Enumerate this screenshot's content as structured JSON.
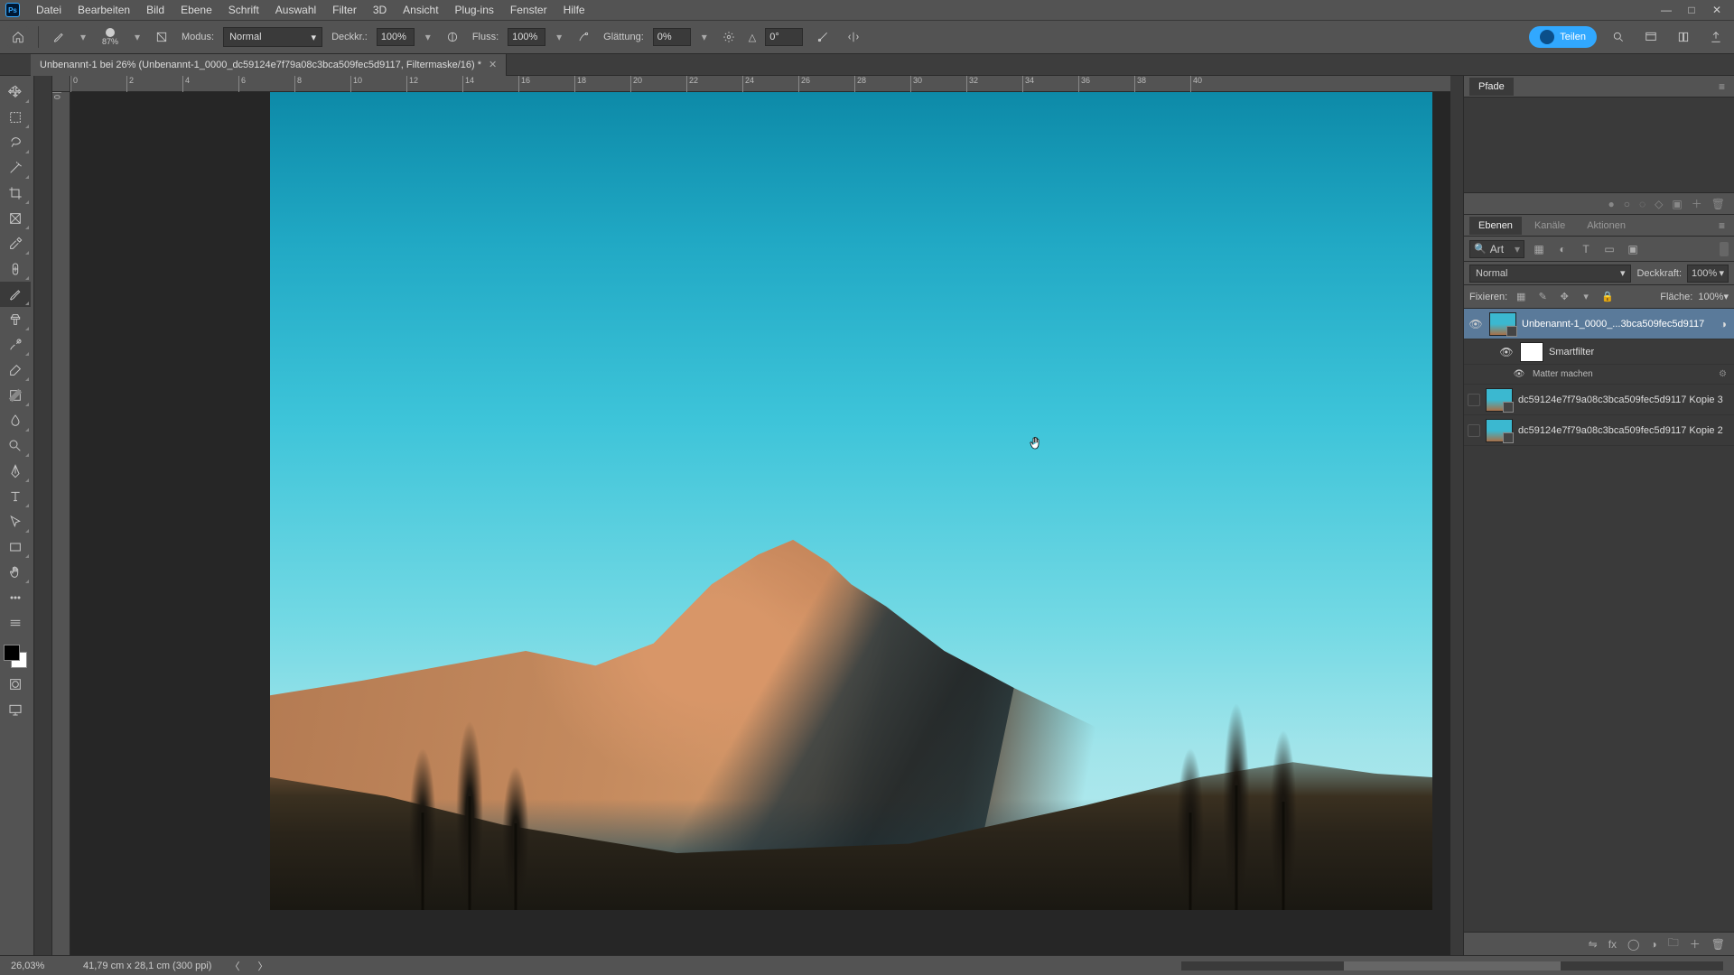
{
  "menubar": [
    "Datei",
    "Bearbeiten",
    "Bild",
    "Ebene",
    "Schrift",
    "Auswahl",
    "Filter",
    "3D",
    "Ansicht",
    "Plug-ins",
    "Fenster",
    "Hilfe"
  ],
  "optbar": {
    "brush_size": "87%",
    "modus_label": "Modus:",
    "modus_value": "Normal",
    "deckkr_label": "Deckkr.:",
    "deckkr_value": "100%",
    "fluss_label": "Fluss:",
    "fluss_value": "100%",
    "glatt_label": "Glättung:",
    "glatt_value": "0%",
    "angle_icon": "△",
    "angle_value": "0°",
    "share_label": "Teilen"
  },
  "doc_tab": {
    "title": "Unbenannt-1 bei 26% (Unbenannt-1_0000_dc59124e7f79a08c3bca509fec5d9117, Filtermaske/16) *"
  },
  "ruler_h": [
    "0",
    "2",
    "4",
    "6",
    "8",
    "10",
    "12",
    "14",
    "16",
    "18",
    "20",
    "22",
    "24",
    "26",
    "28",
    "30",
    "32",
    "34",
    "36",
    "38",
    "40"
  ],
  "ruler_v": [
    "0",
    "",
    "",
    "",
    "",
    "",
    "",
    "",
    "",
    "",
    "",
    "",
    "",
    ""
  ],
  "panels": {
    "pfade_tab": "Pfade",
    "layer_tabs": [
      "Ebenen",
      "Kanäle",
      "Aktionen"
    ],
    "filter_kind": "Art",
    "blend_mode": "Normal",
    "opacity_label": "Deckkraft:",
    "opacity_value": "100%",
    "lock_label": "Fixieren:",
    "fill_label": "Fläche:",
    "fill_value": "100%"
  },
  "layers": {
    "l0_name": "Unbenannt-1_0000_...3bca509fec5d9117",
    "smartfilter_label": "Smartfilter",
    "sf_item": "Matter machen",
    "l1_name": "dc59124e7f79a08c3bca509fec5d9117 Kopie 3",
    "l2_name": "dc59124e7f79a08c3bca509fec5d9117 Kopie 2"
  },
  "status": {
    "zoom": "26,03%",
    "dims": "41,79 cm x 28,1 cm (300 ppi)"
  }
}
